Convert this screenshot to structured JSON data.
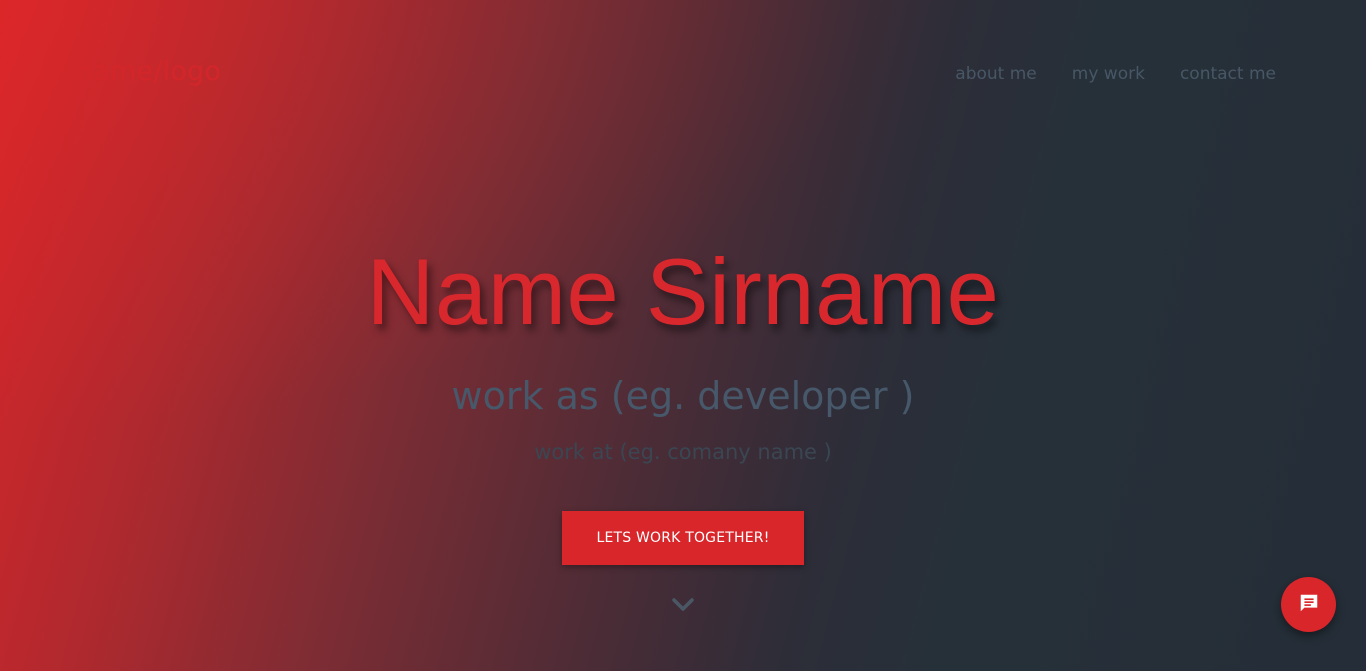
{
  "header": {
    "logo_text": "name/logo",
    "nav": {
      "about": "about me",
      "work": "my work",
      "contact": "contact me"
    }
  },
  "hero": {
    "title": "Name Sirname",
    "subtitle": "work as (eg. developer )",
    "subsubtitle": "work at (eg. comany name )",
    "cta_label": "LETS WORK TOGETHER!"
  },
  "icons": {
    "scroll": "chevron-down-icon",
    "chat": "chat-icon"
  },
  "colors": {
    "accent": "#d8262a",
    "nav_text": "#485766",
    "subtitle_text": "#46586a",
    "background_dark": "#252e38"
  }
}
